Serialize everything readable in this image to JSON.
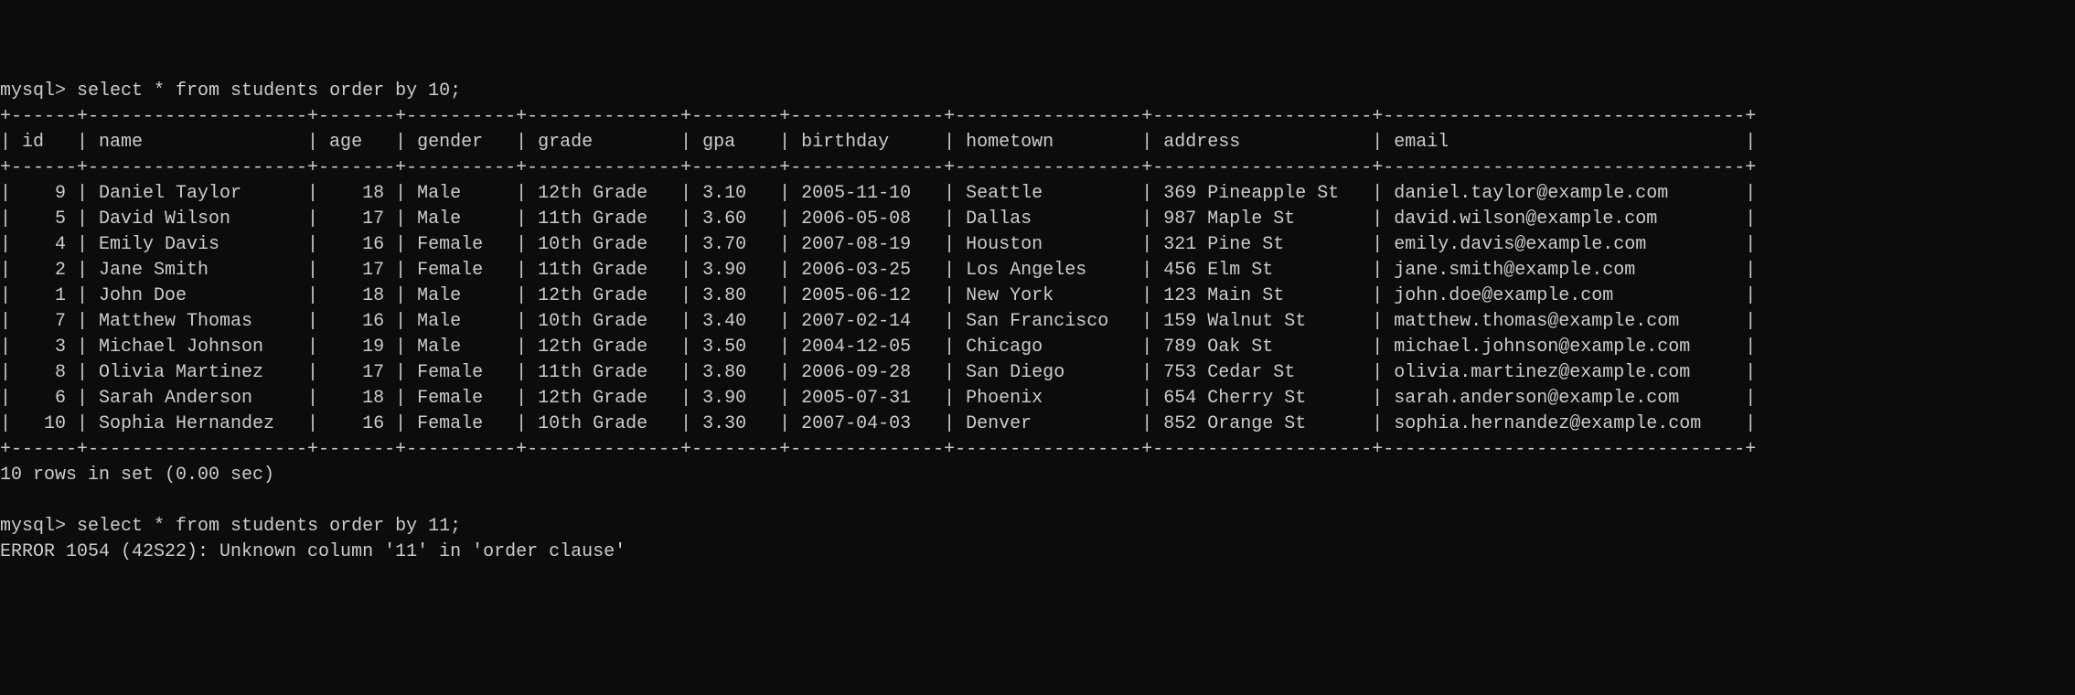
{
  "chart_data": {
    "type": "table",
    "title": "students",
    "columns": [
      "id",
      "name",
      "age",
      "gender",
      "grade",
      "gpa",
      "birthday",
      "hometown",
      "address",
      "email"
    ],
    "rows": [
      [
        9,
        "Daniel Taylor",
        18,
        "Male",
        "12th Grade",
        3.1,
        "2005-11-10",
        "Seattle",
        "369 Pineapple St",
        "daniel.taylor@example.com"
      ],
      [
        5,
        "David Wilson",
        17,
        "Male",
        "11th Grade",
        3.6,
        "2006-05-08",
        "Dallas",
        "987 Maple St",
        "david.wilson@example.com"
      ],
      [
        4,
        "Emily Davis",
        16,
        "Female",
        "10th Grade",
        3.7,
        "2007-08-19",
        "Houston",
        "321 Pine St",
        "emily.davis@example.com"
      ],
      [
        2,
        "Jane Smith",
        17,
        "Female",
        "11th Grade",
        3.9,
        "2006-03-25",
        "Los Angeles",
        "456 Elm St",
        "jane.smith@example.com"
      ],
      [
        1,
        "John Doe",
        18,
        "Male",
        "12th Grade",
        3.8,
        "2005-06-12",
        "New York",
        "123 Main St",
        "john.doe@example.com"
      ],
      [
        7,
        "Matthew Thomas",
        16,
        "Male",
        "10th Grade",
        3.4,
        "2007-02-14",
        "San Francisco",
        "159 Walnut St",
        "matthew.thomas@example.com"
      ],
      [
        3,
        "Michael Johnson",
        19,
        "Male",
        "12th Grade",
        3.5,
        "2004-12-05",
        "Chicago",
        "789 Oak St",
        "michael.johnson@example.com"
      ],
      [
        8,
        "Olivia Martinez",
        17,
        "Female",
        "11th Grade",
        3.8,
        "2006-09-28",
        "San Diego",
        "753 Cedar St",
        "olivia.martinez@example.com"
      ],
      [
        6,
        "Sarah Anderson",
        18,
        "Female",
        "12th Grade",
        3.9,
        "2005-07-31",
        "Phoenix",
        "654 Cherry St",
        "sarah.anderson@example.com"
      ],
      [
        10,
        "Sophia Hernandez",
        16,
        "Female",
        "10th Grade",
        3.3,
        "2007-04-03",
        "Denver",
        "852 Orange St",
        "sophia.hernandez@example.com"
      ]
    ]
  },
  "terminal": {
    "prompt": "mysql>",
    "query1": "select * from students order by 10;",
    "query2": "select * from students order by 11;",
    "result_summary": "10 rows in set (0.00 sec)",
    "error_message": "ERROR 1054 (42S22): Unknown column '11' in 'order clause'",
    "columns": {
      "id": "id",
      "name": "name",
      "age": "age",
      "gender": "gender",
      "grade": "grade",
      "gpa": "gpa",
      "birthday": "birthday",
      "hometown": "hometown",
      "address": "address",
      "email": "email"
    },
    "column_widths": {
      "id": 4,
      "name": 18,
      "age": 5,
      "gender": 8,
      "grade": 12,
      "gpa": 6,
      "birthday": 12,
      "hometown": 15,
      "address": 18,
      "email": 31
    },
    "rows": [
      {
        "id": "9",
        "name": "Daniel Taylor",
        "age": "18",
        "gender": "Male",
        "grade": "12th Grade",
        "gpa": "3.10",
        "birthday": "2005-11-10",
        "hometown": "Seattle",
        "address": "369 Pineapple St",
        "email": "daniel.taylor@example.com"
      },
      {
        "id": "5",
        "name": "David Wilson",
        "age": "17",
        "gender": "Male",
        "grade": "11th Grade",
        "gpa": "3.60",
        "birthday": "2006-05-08",
        "hometown": "Dallas",
        "address": "987 Maple St",
        "email": "david.wilson@example.com"
      },
      {
        "id": "4",
        "name": "Emily Davis",
        "age": "16",
        "gender": "Female",
        "grade": "10th Grade",
        "gpa": "3.70",
        "birthday": "2007-08-19",
        "hometown": "Houston",
        "address": "321 Pine St",
        "email": "emily.davis@example.com"
      },
      {
        "id": "2",
        "name": "Jane Smith",
        "age": "17",
        "gender": "Female",
        "grade": "11th Grade",
        "gpa": "3.90",
        "birthday": "2006-03-25",
        "hometown": "Los Angeles",
        "address": "456 Elm St",
        "email": "jane.smith@example.com"
      },
      {
        "id": "1",
        "name": "John Doe",
        "age": "18",
        "gender": "Male",
        "grade": "12th Grade",
        "gpa": "3.80",
        "birthday": "2005-06-12",
        "hometown": "New York",
        "address": "123 Main St",
        "email": "john.doe@example.com"
      },
      {
        "id": "7",
        "name": "Matthew Thomas",
        "age": "16",
        "gender": "Male",
        "grade": "10th Grade",
        "gpa": "3.40",
        "birthday": "2007-02-14",
        "hometown": "San Francisco",
        "address": "159 Walnut St",
        "email": "matthew.thomas@example.com"
      },
      {
        "id": "3",
        "name": "Michael Johnson",
        "age": "19",
        "gender": "Male",
        "grade": "12th Grade",
        "gpa": "3.50",
        "birthday": "2004-12-05",
        "hometown": "Chicago",
        "address": "789 Oak St",
        "email": "michael.johnson@example.com"
      },
      {
        "id": "8",
        "name": "Olivia Martinez",
        "age": "17",
        "gender": "Female",
        "grade": "11th Grade",
        "gpa": "3.80",
        "birthday": "2006-09-28",
        "hometown": "San Diego",
        "address": "753 Cedar St",
        "email": "olivia.martinez@example.com"
      },
      {
        "id": "6",
        "name": "Sarah Anderson",
        "age": "18",
        "gender": "Female",
        "grade": "12th Grade",
        "gpa": "3.90",
        "birthday": "2005-07-31",
        "hometown": "Phoenix",
        "address": "654 Cherry St",
        "email": "sarah.anderson@example.com"
      },
      {
        "id": "10",
        "name": "Sophia Hernandez",
        "age": "16",
        "gender": "Female",
        "grade": "10th Grade",
        "gpa": "3.30",
        "birthday": "2007-04-03",
        "hometown": "Denver",
        "address": "852 Orange St",
        "email": "sophia.hernandez@example.com"
      }
    ]
  }
}
